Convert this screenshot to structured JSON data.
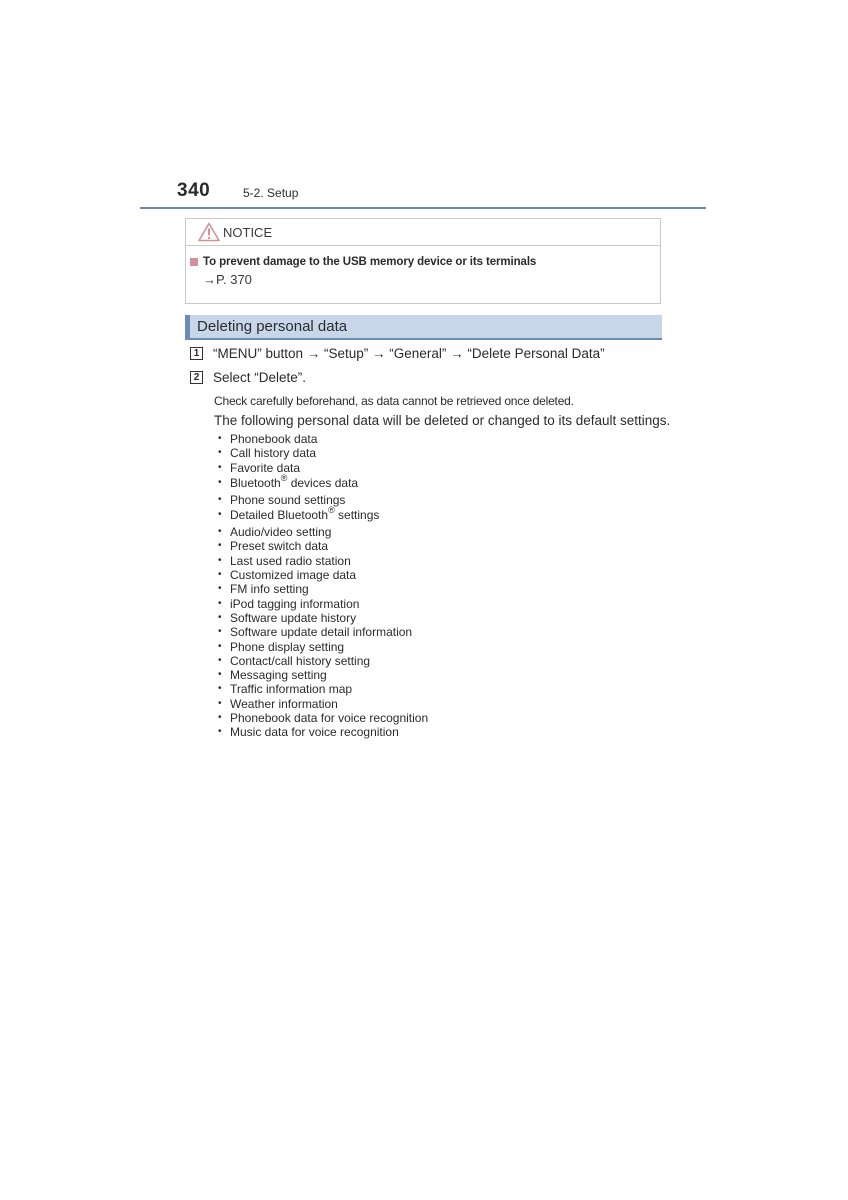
{
  "header": {
    "page_number": "340",
    "section": "5-2. Setup"
  },
  "notice": {
    "title": "NOTICE",
    "icon": "warning-triangle-icon",
    "item_heading": "To prevent damage to the USB memory device or its terminals",
    "item_reference": "→P. 370"
  },
  "section": {
    "title": "Deleting personal data"
  },
  "steps": [
    {
      "number": "1",
      "text": "“MENU” button → “Setup” → “General” → “Delete Personal Data”"
    },
    {
      "number": "2",
      "text": "Select “Delete”."
    }
  ],
  "paragraphs": [
    "Check carefully beforehand, as data cannot be retrieved once deleted.",
    "The following personal data will be deleted or changed to its default settings."
  ],
  "bullet_symbol": "•",
  "registered_mark": "®",
  "personal_data_items": [
    {
      "text": "Phonebook data"
    },
    {
      "text": "Call history data"
    },
    {
      "text": "Favorite data"
    },
    {
      "text": "Bluetooth",
      "sup": "®",
      "after": " devices data"
    },
    {
      "text": "Phone sound settings"
    },
    {
      "text": "Detailed Bluetooth",
      "sup": "®",
      "after": " settings"
    },
    {
      "text": "Audio/video setting"
    },
    {
      "text": "Preset switch data"
    },
    {
      "text": "Last used radio station"
    },
    {
      "text": "Customized image data"
    },
    {
      "text": "FM info setting"
    },
    {
      "text": "iPod tagging information"
    },
    {
      "text": "Software update history"
    },
    {
      "text": "Software update detail information"
    },
    {
      "text": "Phone display setting"
    },
    {
      "text": "Contact/call history setting"
    },
    {
      "text": "Messaging setting"
    },
    {
      "text": "Traffic information map"
    },
    {
      "text": "Weather information"
    },
    {
      "text": "Phonebook data for voice recognition"
    },
    {
      "text": "Music data for voice recognition"
    }
  ],
  "colors": {
    "accent_blue": "#6b8ab5",
    "section_bar_fill": "#c8d6ea",
    "notice_red": "#d4919a"
  }
}
